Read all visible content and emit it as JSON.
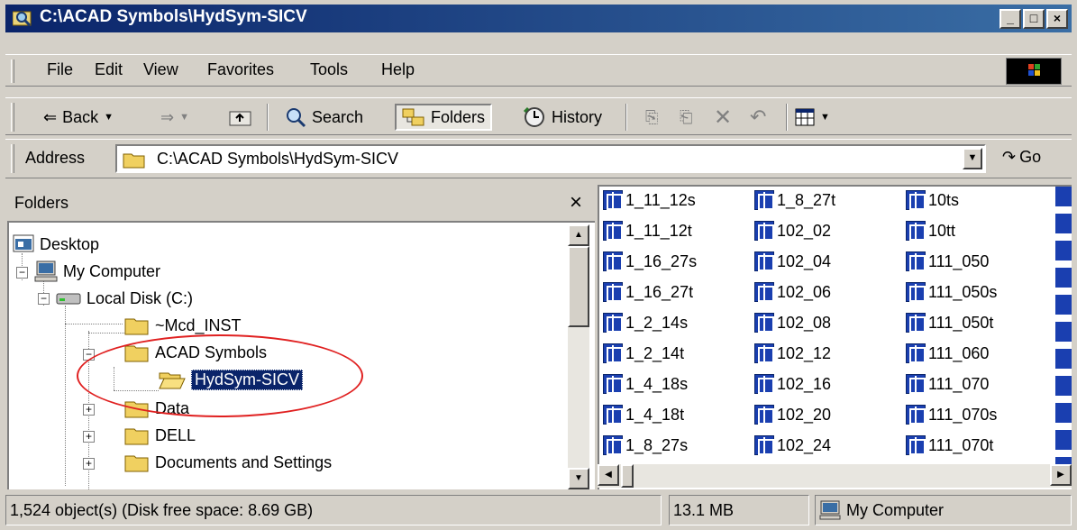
{
  "window": {
    "title": "C:\\ACAD Symbols\\HydSym-SICV",
    "buttons": {
      "minimize": "_",
      "maximize": "□",
      "close": "×"
    }
  },
  "menubar": {
    "items": [
      "File",
      "Edit",
      "View",
      "Favorites",
      "Tools",
      "Help"
    ]
  },
  "toolbar": {
    "back_label": "Back",
    "search_label": "Search",
    "folders_label": "Folders",
    "history_label": "History"
  },
  "address": {
    "label": "Address",
    "value": "C:\\ACAD Symbols\\HydSym-SICV",
    "go_label": "Go"
  },
  "folders_pane": {
    "title": "Folders",
    "close": "×",
    "tree": [
      {
        "label": "Desktop",
        "level": 0
      },
      {
        "label": "My Computer",
        "level": 1
      },
      {
        "label": "Local Disk (C:)",
        "level": 2
      },
      {
        "label": "~Mcd_INST",
        "level": 3
      },
      {
        "label": "ACAD Symbols",
        "level": 3
      },
      {
        "label": "HydSym-SICV",
        "level": 4,
        "selected": true
      },
      {
        "label": "Data",
        "level": 3
      },
      {
        "label": "DELL",
        "level": 3
      },
      {
        "label": "Documents and Settings",
        "level": 3
      }
    ]
  },
  "files": {
    "columns": [
      [
        "1_11_12s",
        "1_11_12t",
        "1_16_27s",
        "1_16_27t",
        "1_2_14s",
        "1_2_14t",
        "1_4_18s",
        "1_4_18t",
        "1_8_27s"
      ],
      [
        "1_8_27t",
        "102_02",
        "102_04",
        "102_06",
        "102_08",
        "102_12",
        "102_16",
        "102_20",
        "102_24"
      ],
      [
        "10ts",
        "10tt",
        "111_050",
        "111_050s",
        "111_050t",
        "111_060",
        "111_070",
        "111_070s",
        "111_070t"
      ]
    ]
  },
  "status": {
    "objects": "1,524 object(s) (Disk free space: 8.69 GB)",
    "size": "13.1 MB",
    "zone": "My Computer"
  },
  "colors": {
    "titlebar": "#0a246a",
    "selection": "#0a246a",
    "highlight_oval": "#e02020",
    "chrome": "#d4d0c8"
  }
}
